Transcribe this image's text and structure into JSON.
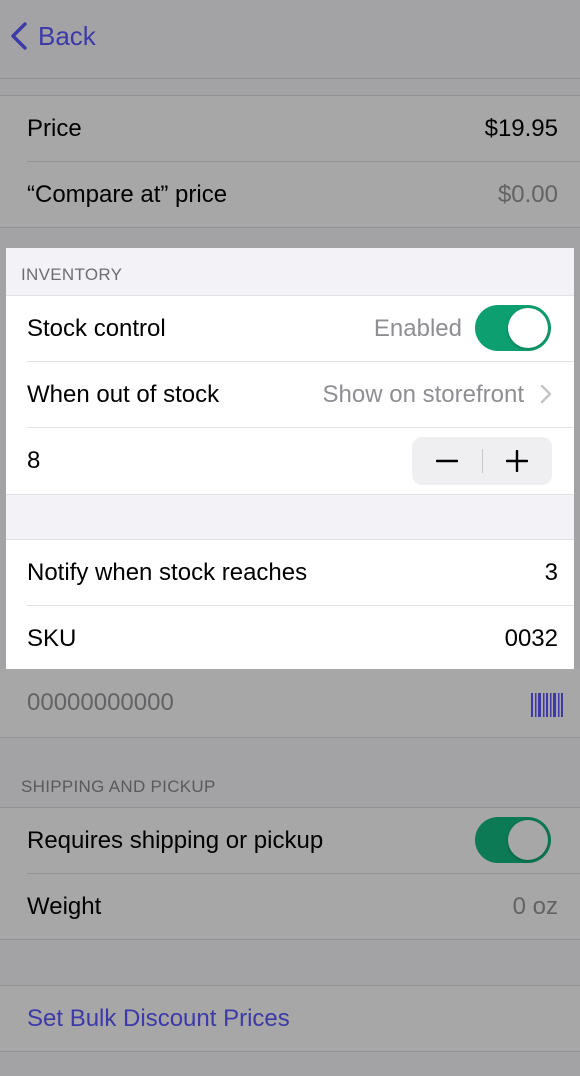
{
  "nav": {
    "back_label": "Back"
  },
  "pricing": {
    "price_label": "Price",
    "price_value": "$19.95",
    "compare_label": "“Compare at” price",
    "compare_value": "$0.00"
  },
  "inventory": {
    "header": "INVENTORY",
    "stock_control_label": "Stock control",
    "stock_control_value": "Enabled",
    "stock_control_on": true,
    "out_of_stock_label": "When out of stock",
    "out_of_stock_value": "Show on storefront",
    "quantity": "8",
    "notify_label": "Notify when stock reaches",
    "notify_value": "3",
    "sku_label": "SKU",
    "sku_value": "0032"
  },
  "barcode": {
    "placeholder": "00000000000",
    "icon": "barcode-icon"
  },
  "shipping": {
    "header": "SHIPPING AND PICKUP",
    "requires_label": "Requires shipping or pickup",
    "requires_on": true,
    "weight_label": "Weight",
    "weight_value": "0 oz"
  },
  "bulk": {
    "label": "Set Bulk Discount Prices"
  },
  "colors": {
    "accent": "#3d3aa8",
    "toggle_on": "#0d9f6f",
    "dim_overlay": "#a3a3a6"
  }
}
